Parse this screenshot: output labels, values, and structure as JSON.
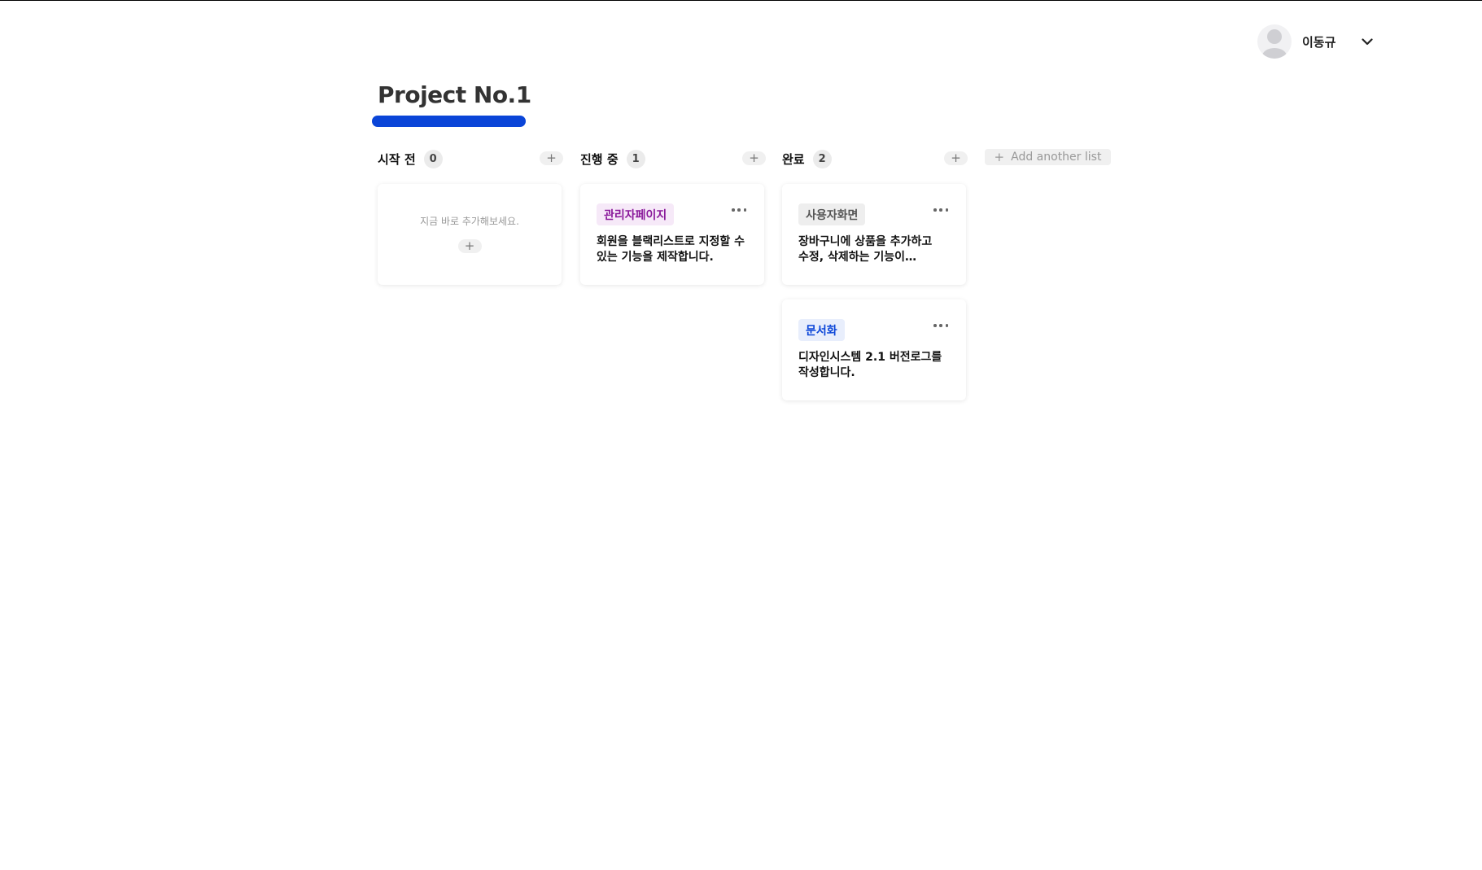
{
  "user": {
    "name": "이동규"
  },
  "project": {
    "title": "Project No.1",
    "accent_color": "#0a45d8"
  },
  "columns": [
    {
      "title": "시작 전",
      "count": "0",
      "add_label": "+",
      "empty_text": "지금 바로 추가해보세요.",
      "empty_add_label": "+",
      "cards": []
    },
    {
      "title": "진행 중",
      "count": "1",
      "add_label": "+",
      "cards": [
        {
          "tag": "관리자페이지",
          "tag_color": "#8a1a9b",
          "tag_bg": "#f6e9f8",
          "description": "회원을 블랙리스트로 지정할 수 있는 기능을 제작합니다."
        }
      ]
    },
    {
      "title": "완료",
      "count": "2",
      "add_label": "+",
      "cards": [
        {
          "tag": "사용자화면",
          "tag_color": "#555555",
          "tag_bg": "#eeeeee",
          "description": "장바구니에 상품을 추가하고 수정, 삭제하는 기능이 포함됩니다."
        },
        {
          "tag": "문서화",
          "tag_color": "#0a45d8",
          "tag_bg": "#e8eefc",
          "description": "디자인시스템 2.1 버전로그를 작성합니다."
        }
      ]
    }
  ],
  "add_list": {
    "icon": "+",
    "label": "Add another list"
  }
}
